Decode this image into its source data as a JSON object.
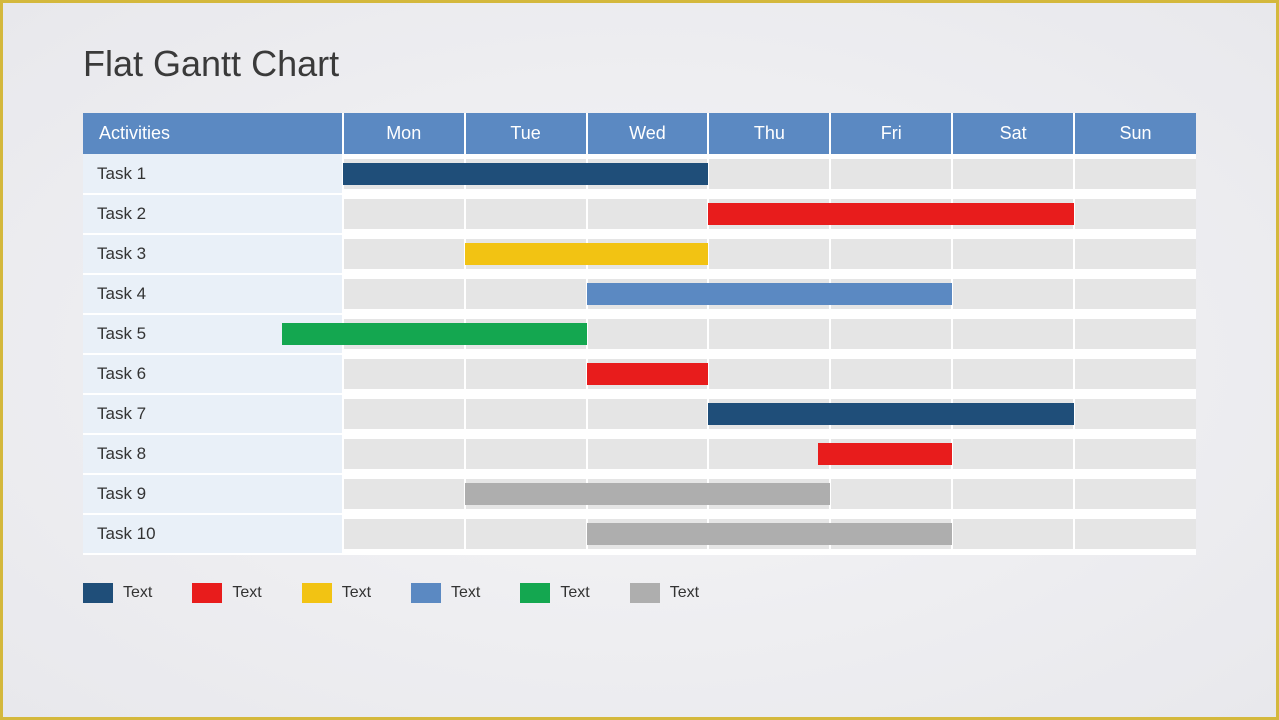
{
  "title": "Flat Gantt Chart",
  "columns": {
    "activities_header": "Activities",
    "days": [
      "Mon",
      "Tue",
      "Wed",
      "Thu",
      "Fri",
      "Sat",
      "Sun"
    ]
  },
  "tasks": [
    "Task 1",
    "Task 2",
    "Task 3",
    "Task 4",
    "Task 5",
    "Task 6",
    "Task 7",
    "Task 8",
    "Task 9",
    "Task 10"
  ],
  "colors": {
    "dark_blue": "#1f4e79",
    "red": "#e81c1c",
    "yellow": "#f2c313",
    "blue": "#5b89c2",
    "green": "#14a750",
    "gray": "#aeaeae"
  },
  "legend": [
    {
      "color": "#1f4e79",
      "label": "Text"
    },
    {
      "color": "#e81c1c",
      "label": "Text"
    },
    {
      "color": "#f2c313",
      "label": "Text"
    },
    {
      "color": "#5b89c2",
      "label": "Text"
    },
    {
      "color": "#14a750",
      "label": "Text"
    },
    {
      "color": "#aeaeae",
      "label": "Text"
    }
  ],
  "chart_data": {
    "type": "gantt",
    "title": "Flat Gantt Chart",
    "x_categories": [
      "Mon",
      "Tue",
      "Wed",
      "Thu",
      "Fri",
      "Sat",
      "Sun"
    ],
    "series": [
      {
        "name": "Task 1",
        "start": "Mon",
        "end": "Wed",
        "start_offset": 0.0,
        "end_offset": 1.0,
        "color": "#1f4e79"
      },
      {
        "name": "Task 2",
        "start": "Thu",
        "end": "Sat",
        "start_offset": 0.0,
        "end_offset": 1.0,
        "color": "#e81c1c"
      },
      {
        "name": "Task 3",
        "start": "Tue",
        "end": "Wed",
        "start_offset": 0.0,
        "end_offset": 1.0,
        "color": "#f2c313"
      },
      {
        "name": "Task 4",
        "start": "Wed",
        "end": "Fri",
        "start_offset": 0.0,
        "end_offset": 1.0,
        "color": "#5b89c2"
      },
      {
        "name": "Task 5",
        "start": "Mon",
        "end": "Tue",
        "start_offset": -0.5,
        "end_offset": 1.0,
        "color": "#14a750"
      },
      {
        "name": "Task 6",
        "start": "Wed",
        "end": "Wed",
        "start_offset": 0.0,
        "end_offset": 1.0,
        "color": "#e81c1c"
      },
      {
        "name": "Task 7",
        "start": "Thu",
        "end": "Sat",
        "start_offset": 0.0,
        "end_offset": 1.0,
        "color": "#1f4e79"
      },
      {
        "name": "Task 8",
        "start": "Fri",
        "end": "Fri",
        "start_offset": -0.1,
        "end_offset": 1.0,
        "color": "#e81c1c"
      },
      {
        "name": "Task 9",
        "start": "Tue",
        "end": "Thu",
        "start_offset": 0.0,
        "end_offset": 1.0,
        "color": "#aeaeae"
      },
      {
        "name": "Task 10",
        "start": "Wed",
        "end": "Fri",
        "start_offset": 0.0,
        "end_offset": 1.0,
        "color": "#aeaeae"
      }
    ]
  }
}
